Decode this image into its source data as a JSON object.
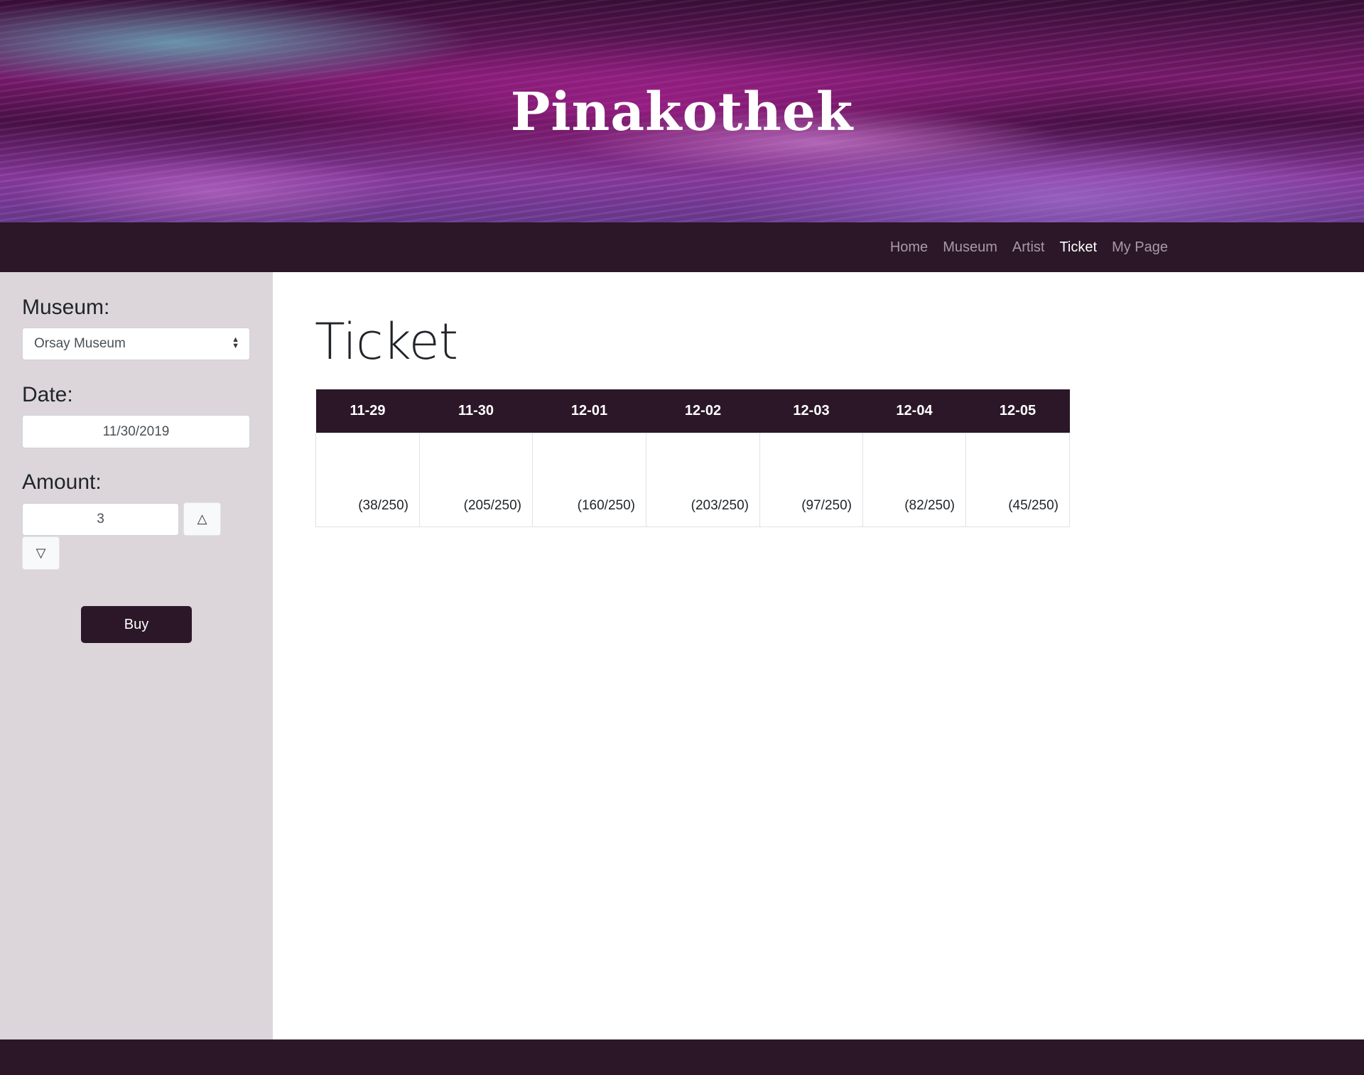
{
  "header": {
    "site_title": "Pinakothek"
  },
  "nav": {
    "items": [
      {
        "label": "Home",
        "active": false
      },
      {
        "label": "Museum",
        "active": false
      },
      {
        "label": "Artist",
        "active": false
      },
      {
        "label": "Ticket",
        "active": true
      },
      {
        "label": "My Page",
        "active": false
      }
    ]
  },
  "sidebar": {
    "museum_label": "Museum:",
    "museum_value": "Orsay Museum",
    "date_label": "Date:",
    "date_value": "11/30/2019",
    "amount_label": "Amount:",
    "amount_value": "3",
    "buy_label": "Buy"
  },
  "main": {
    "title": "Ticket",
    "table": {
      "columns": [
        "11-29",
        "11-30",
        "12-01",
        "12-02",
        "12-03",
        "12-04",
        "12-05"
      ],
      "cells": [
        "(38/250)",
        "(205/250)",
        "(160/250)",
        "(203/250)",
        "(97/250)",
        "(82/250)",
        "(45/250)"
      ]
    }
  },
  "colors": {
    "dark_purple": "#2b1728",
    "sidebar_bg": "#dcd6da",
    "nav_inactive": "#a99aa6"
  },
  "icons": {
    "step_up": "triangle-up-icon",
    "step_down": "triangle-down-icon",
    "select_arrows": "sort-arrows-icon"
  }
}
